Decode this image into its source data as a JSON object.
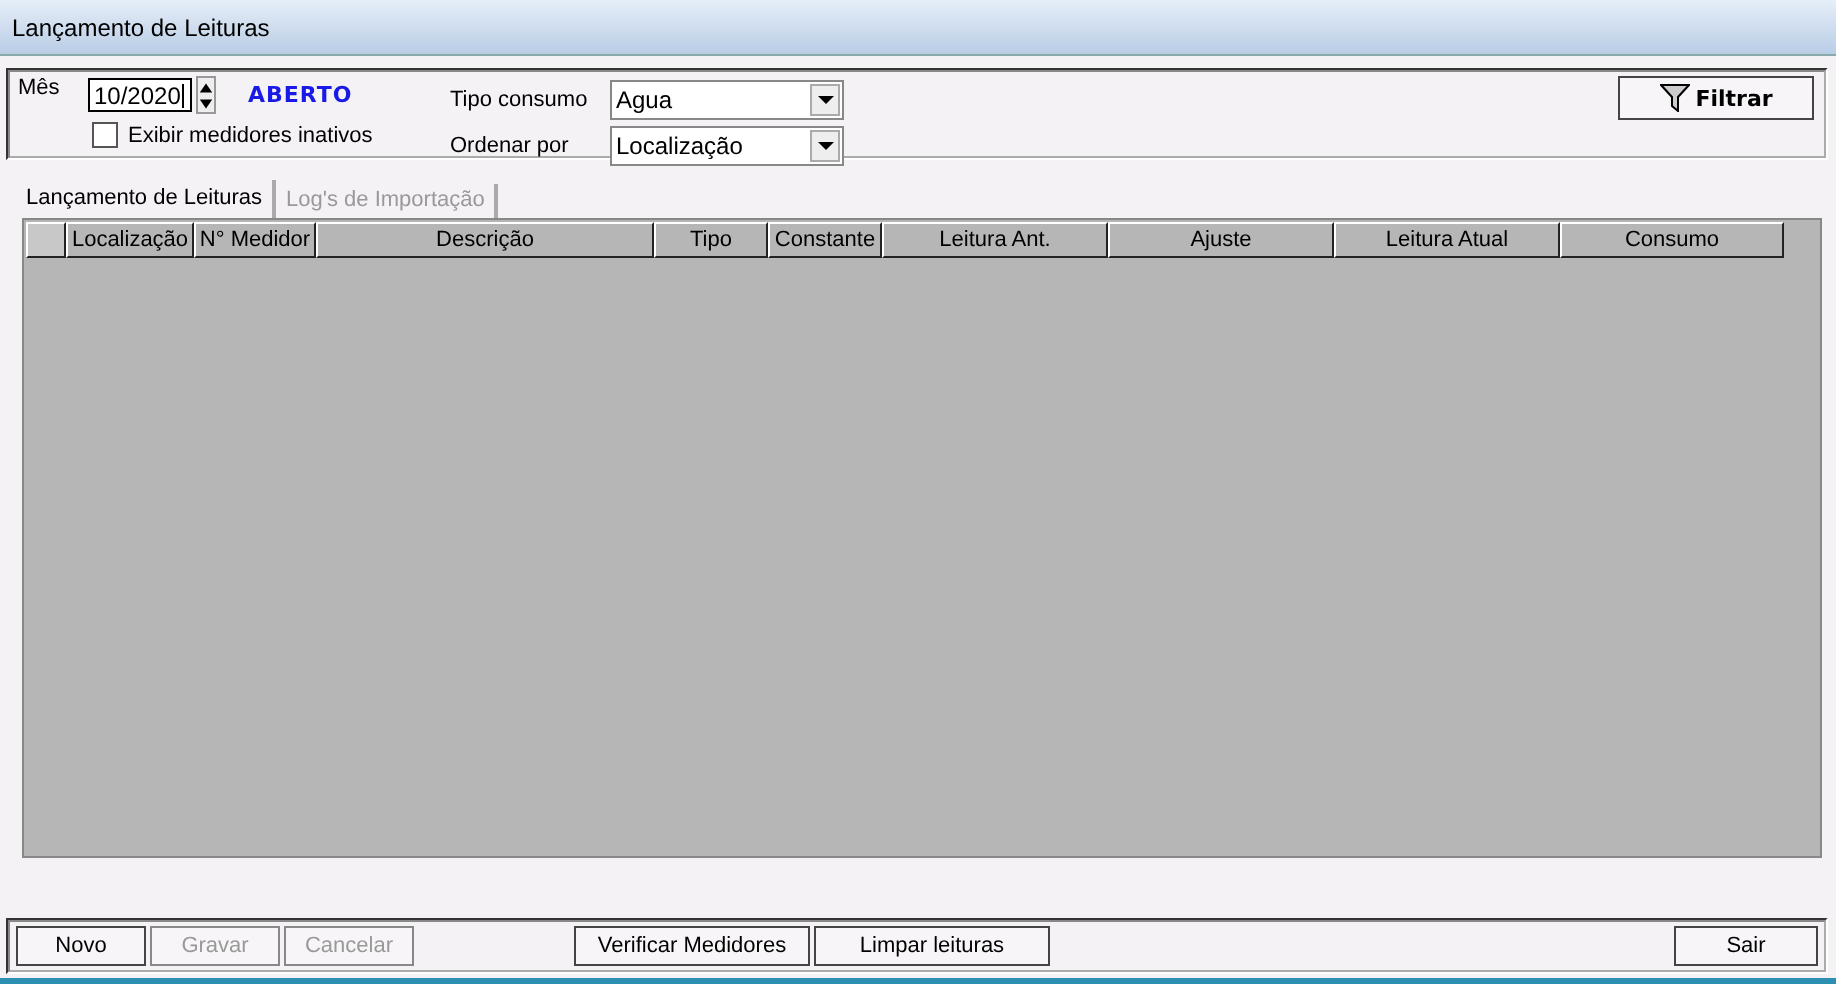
{
  "window": {
    "title": "Lançamento de Leituras"
  },
  "filters": {
    "month_label": "Mês",
    "month": "10/2020",
    "status": "ABERTO",
    "show_inactive": {
      "label": "Exibir medidores inativos",
      "checked": false
    },
    "consumption_type": {
      "label": "Tipo consumo",
      "value": "Agua"
    },
    "order_by": {
      "label": "Ordenar por",
      "value": "Localização"
    },
    "filter_button": "Filtrar"
  },
  "tabs": [
    {
      "label": "Lançamento de Leituras",
      "selected": true
    },
    {
      "label": "Log's de Importação",
      "selected": false
    }
  ],
  "table": {
    "columns": [
      "Localização",
      "N° Medidor",
      "Descrição",
      "Tipo",
      "Constante",
      "Leitura Ant.",
      "Ajuste",
      "Leitura Atual",
      "Consumo"
    ]
  },
  "bottom_bar": {
    "left": [
      {
        "label": "Novo",
        "disabled": false
      },
      {
        "label": "Gravar",
        "disabled": true
      },
      {
        "label": "Cancelar",
        "disabled": true
      }
    ],
    "middle": [
      {
        "label": "Verificar Medidores",
        "disabled": false
      },
      {
        "label": "Limpar leituras",
        "disabled": false
      }
    ],
    "right": [
      {
        "label": "Sair",
        "disabled": false
      }
    ]
  }
}
